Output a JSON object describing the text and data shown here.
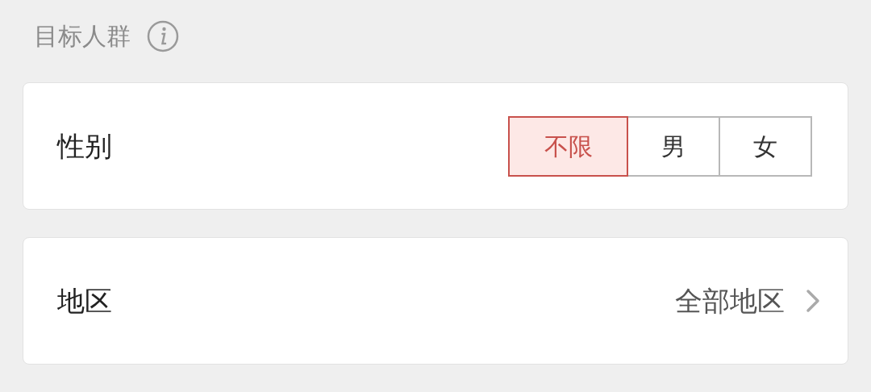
{
  "section": {
    "title": "目标人群"
  },
  "gender": {
    "label": "性别",
    "options": [
      {
        "label": "不限",
        "selected": true
      },
      {
        "label": "男",
        "selected": false
      },
      {
        "label": "女",
        "selected": false
      }
    ]
  },
  "region": {
    "label": "地区",
    "value": "全部地区"
  }
}
